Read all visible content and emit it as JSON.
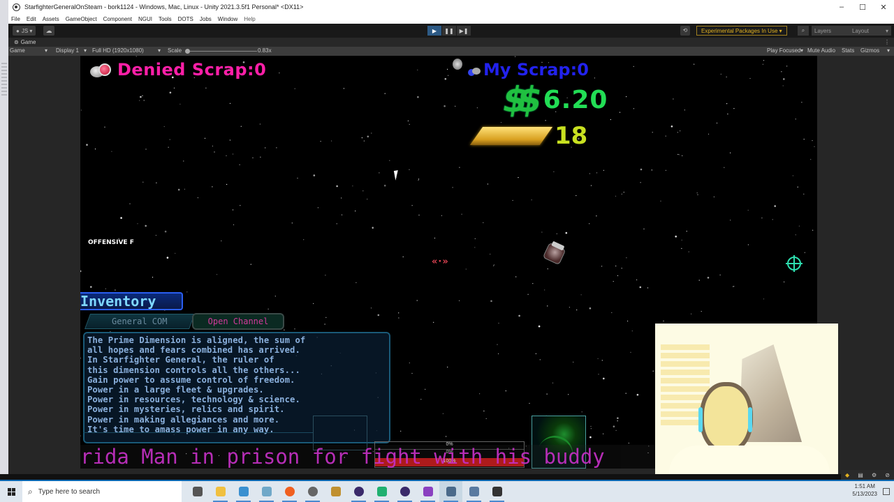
{
  "window": {
    "title": "StarfighterGeneralOnSteam - bork1124 - Windows, Mac, Linux - Unity 2021.3.5f1 Personal* <DX11>",
    "controls": [
      "–",
      "☐",
      "✕"
    ]
  },
  "menu": [
    "File",
    "Edit",
    "Assets",
    "GameObject",
    "Component",
    "NGUI",
    "Tools",
    "DOTS",
    "Jobs",
    "Window",
    "Help"
  ],
  "toolbar": {
    "account": "JS ▾",
    "cloud": "☁",
    "play": "▶",
    "pause": "❚❚",
    "step": "▶❚",
    "experimental": "Experimental Packages In Use ▾",
    "layers": "Layers",
    "layout": "Layout",
    "dropdown_arrow": "▾"
  },
  "tab": {
    "label": "Game",
    "more": "⋮"
  },
  "gameview": {
    "mode": "Game",
    "display": "Display 1",
    "resolution": "Full HD (1920x1080)",
    "scale_label": "Scale",
    "scale_value": "0.83x",
    "play_focused": "Play Focused",
    "mute_audio": "Mute Audio",
    "stats": "Stats",
    "gizmos": "Gizmos"
  },
  "hud": {
    "denied_scrap": "Denied Scrap:0",
    "my_scrap": "My Scrap:0",
    "money": "6.20",
    "money_symbol": "$$",
    "gold": "18",
    "offensive_label": "OFFENSIVE F",
    "nav_chevrons": "«·»"
  },
  "inventory": {
    "title": "Inventory",
    "tabs": [
      "General COM",
      "Open Channel"
    ],
    "chat_lines": [
      "The Prime Dimension is aligned, the sum of",
      "all hopes and fears combined has arrived.",
      "In Starfighter General, the ruler of",
      "this dimension controls all the others...",
      "Gain power to assume control of freedom.",
      "Power in a large fleet & upgrades.",
      "Power in resources, technology & science.",
      "Power in mysteries, relics and spirit.",
      "Power in making allegiances and more.",
      "It's time to amass power in any way."
    ]
  },
  "progress": {
    "label1": "0%",
    "label2": "0%",
    "label3": "100%",
    "value": 1.0,
    "color": "#d81818"
  },
  "ticker": "rida Man in prison for fight with his buddy",
  "taskbar": {
    "search_placeholder": "Type here to search",
    "apps": [
      {
        "name": "task-view",
        "color": "#555"
      },
      {
        "name": "file-explorer",
        "color": "#f0c040"
      },
      {
        "name": "app-monitor",
        "color": "#3a90d0"
      },
      {
        "name": "app-notepad",
        "color": "#70a8c8"
      },
      {
        "name": "firefox",
        "color": "#f06020"
      },
      {
        "name": "unity-hub",
        "color": "#666"
      },
      {
        "name": "league",
        "color": "#c09030"
      },
      {
        "name": "eclipse-1",
        "color": "#3a2a6a"
      },
      {
        "name": "app-green",
        "color": "#20b070"
      },
      {
        "name": "eclipse-2",
        "color": "#3a2a6a"
      },
      {
        "name": "visual-studio",
        "color": "#8a40c0"
      },
      {
        "name": "unity-editor",
        "color": "#4a6a8a"
      },
      {
        "name": "app-network",
        "color": "#5a7aa0"
      },
      {
        "name": "unity",
        "color": "#333"
      }
    ],
    "time": "1:51 AM",
    "date": "5/13/2023"
  }
}
